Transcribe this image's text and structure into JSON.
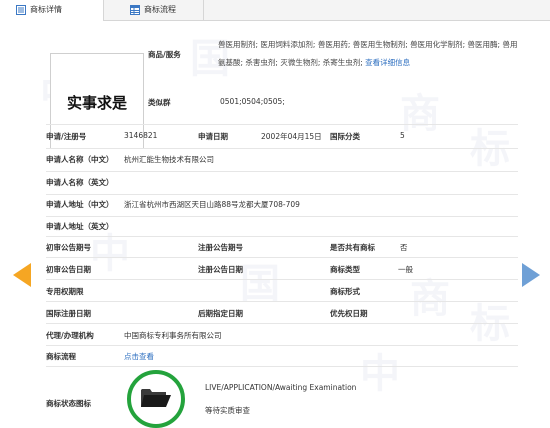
{
  "tabs": [
    {
      "label": "商标详情",
      "active": true,
      "icon": "document-list-icon"
    },
    {
      "label": "商标流程",
      "active": false,
      "icon": "table-grid-icon"
    }
  ],
  "watermark": [
    "中",
    "国",
    "商",
    "标"
  ],
  "mark": {
    "image_text": "实事求是"
  },
  "goods": {
    "label": "商品/服务",
    "text": "兽医用制剂; 医用饲料添加剂; 兽医用药; 兽医用生物制剂; 兽医用化学制剂; 兽医用酶; 兽用氨基酸; 杀害虫剂; 灭微生物剂; 杀寄生虫剂;",
    "link": "查看详细信息"
  },
  "similar_group": {
    "label": "类似群",
    "value": "0501;0504;0505;"
  },
  "fields": {
    "reg_no_label": "申请/注册号",
    "reg_no": "3146821",
    "apply_date_label": "申请日期",
    "apply_date": "2002年04月15日",
    "intl_class_label": "国际分类",
    "intl_class": "5",
    "applicant_cn_label": "申请人名称（中文）",
    "applicant_cn": "杭州汇能生物技术有限公司",
    "applicant_en_label": "申请人名称（英文）",
    "applicant_en": "",
    "address_cn_label": "申请人地址（中文）",
    "address_cn": "浙江省杭州市西湖区天目山路88号龙都大厦708-709",
    "address_en_label": "申请人地址（英文）",
    "address_en": "",
    "prelim_no_label": "初审公告期号",
    "prelim_no": "",
    "reg_pub_no_label": "注册公告期号",
    "reg_pub_no": "",
    "shared_label": "是否共有商标",
    "shared": "否",
    "prelim_date_label": "初审公告日期",
    "prelim_date": "",
    "reg_pub_date_label": "注册公告日期",
    "reg_pub_date": "",
    "mark_type_label": "商标类型",
    "mark_type": "一般",
    "exclusive_label": "专用权期限",
    "exclusive": "",
    "mark_form_label": "商标形式",
    "mark_form": "",
    "intl_reg_date_label": "国际注册日期",
    "intl_reg_date": "",
    "later_date_label": "后期指定日期",
    "later_date": "",
    "priority_label": "优先权日期",
    "priority": "",
    "agent_label": "代理/办理机构",
    "agent": "中国商标专利事务所有限公司",
    "flow_label": "商标流程",
    "flow_link": "点击查看",
    "status_icon_label": "商标状态图标"
  },
  "status": {
    "en": "LIVE/APPLICATION/Awaiting Examination",
    "cn": "等待实质审查",
    "color": "#24a33c"
  },
  "nav": {
    "prev_color": "#f5a623",
    "next_color": "#6fa0d6"
  }
}
